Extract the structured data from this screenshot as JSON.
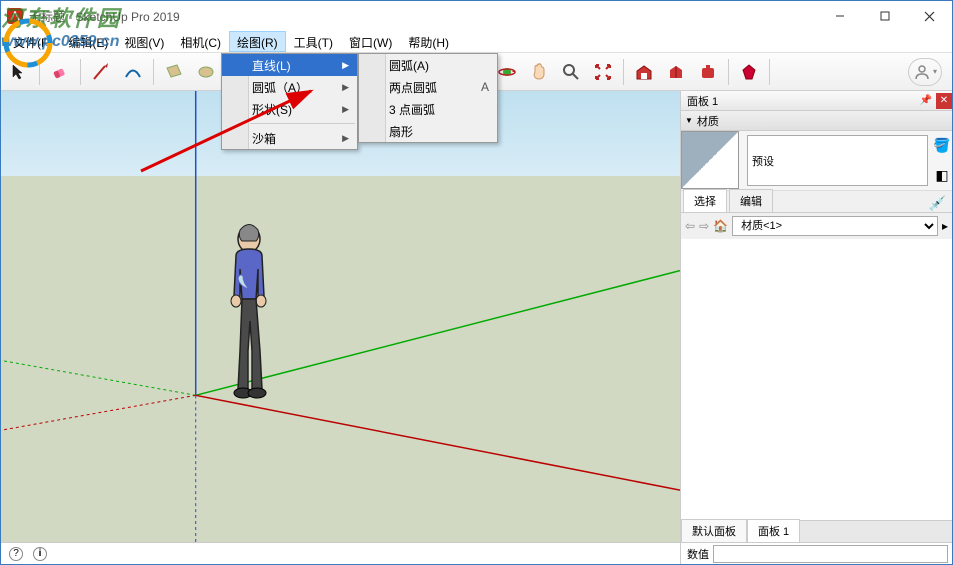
{
  "window": {
    "title": "无标题 - SketchUp Pro 2019"
  },
  "menu": {
    "file": "文件(F)",
    "edit": "编辑(E)",
    "view": "视图(V)",
    "camera": "相机(C)",
    "draw": "绘图(R)",
    "tools": "工具(T)",
    "window": "窗口(W)",
    "help": "帮助(H)"
  },
  "draw_menu": {
    "line": "直线(L)",
    "arc": "圆弧（A）",
    "shape": "形状(S)",
    "sandbox": "沙箱"
  },
  "arc_submenu": {
    "arc": "圆弧(A)",
    "two_point": "两点圆弧",
    "two_point_shortcut": "A",
    "three_point": "3 点画弧",
    "pie": "扇形"
  },
  "panels": {
    "tray_title": "面板 1",
    "materials": "材质",
    "preset_name": "预设",
    "tab_select": "选择",
    "tab_edit": "编辑",
    "material_select_value": "材质<1>",
    "bottom_tab_default": "默认面板",
    "bottom_tab_1": "面板 1"
  },
  "status": {
    "value_label": "数值"
  },
  "watermark": {
    "line1": "河东软件园",
    "line2": "www.pc0359.cn"
  }
}
